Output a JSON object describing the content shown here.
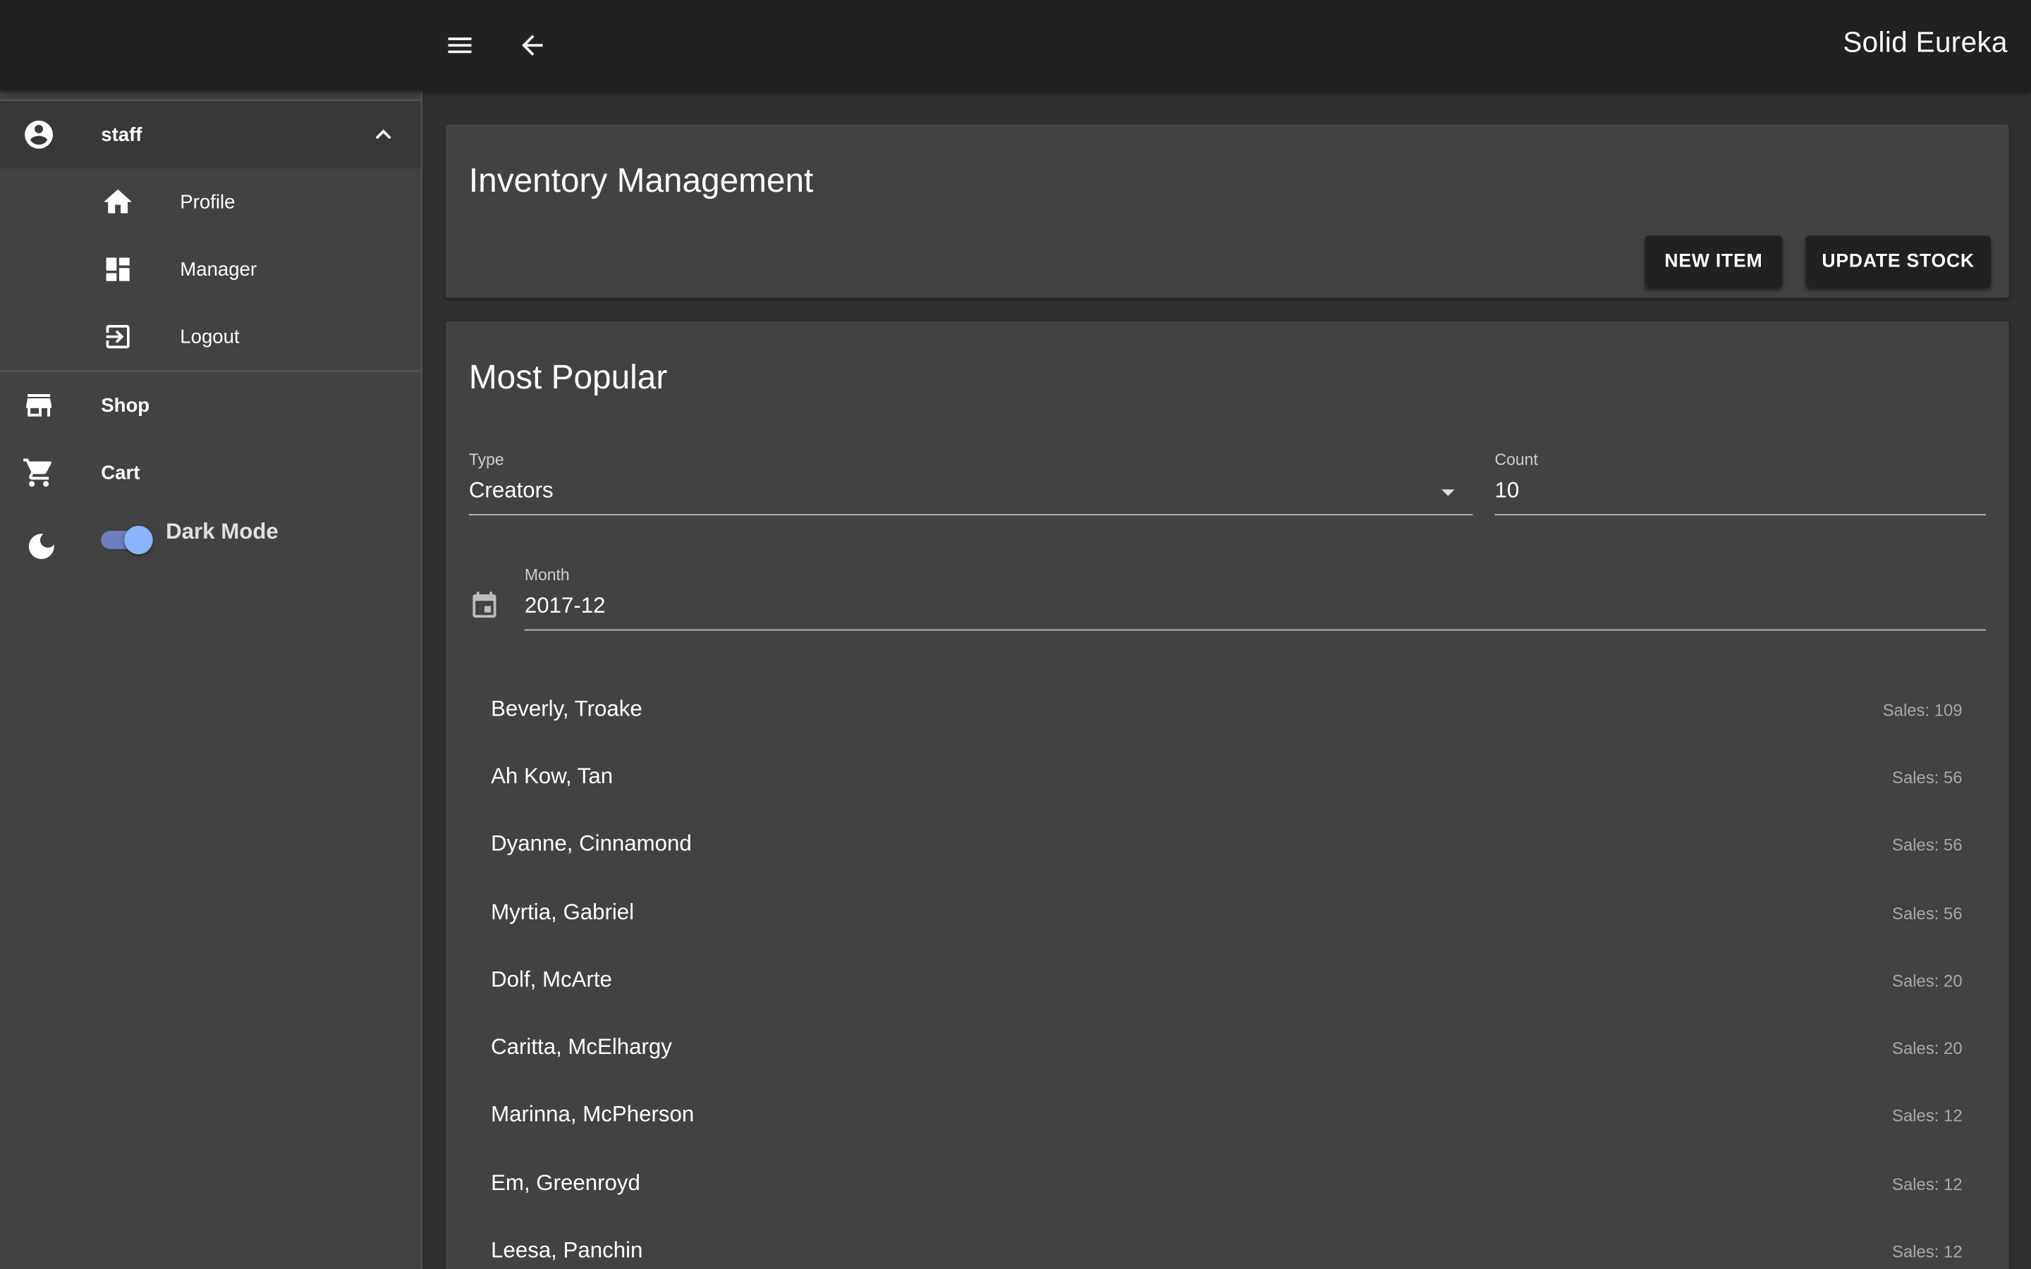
{
  "app": {
    "title": "Solid Eureka"
  },
  "appbar": {
    "menu_icon": "menu-icon",
    "back_icon": "arrow-back-icon"
  },
  "drawer": {
    "group": {
      "label": "staff",
      "icon": "account-circle-icon",
      "expanded": true
    },
    "group_items": [
      {
        "label": "Profile",
        "icon": "home-icon"
      },
      {
        "label": "Manager",
        "icon": "dashboard-icon"
      },
      {
        "label": "Logout",
        "icon": "logout-icon"
      }
    ],
    "items": [
      {
        "label": "Shop",
        "icon": "store-icon"
      },
      {
        "label": "Cart",
        "icon": "cart-icon"
      }
    ],
    "dark_mode": {
      "label": "Dark Mode",
      "icon": "moon-icon",
      "enabled": true
    }
  },
  "inventory": {
    "title": "Inventory Management",
    "new_item_label": "NEW ITEM",
    "update_stock_label": "UPDATE STOCK"
  },
  "popular": {
    "title": "Most Popular",
    "type": {
      "label": "Type",
      "value": "Creators"
    },
    "count": {
      "label": "Count",
      "value": "10"
    },
    "month": {
      "label": "Month",
      "value": "2017-12",
      "icon": "calendar-icon"
    },
    "rows": [
      {
        "name": "Beverly, Troake",
        "sales": "Sales: 109"
      },
      {
        "name": "Ah Kow, Tan",
        "sales": "Sales: 56"
      },
      {
        "name": "Dyanne, Cinnamond",
        "sales": "Sales: 56"
      },
      {
        "name": "Myrtia, Gabriel",
        "sales": "Sales: 56"
      },
      {
        "name": "Dolf, McArte",
        "sales": "Sales: 20"
      },
      {
        "name": "Caritta, McElhargy",
        "sales": "Sales: 20"
      },
      {
        "name": "Marinna, McPherson",
        "sales": "Sales: 12"
      },
      {
        "name": "Em, Greenroyd",
        "sales": "Sales: 12"
      },
      {
        "name": "Leesa, Panchin",
        "sales": "Sales: 12"
      }
    ]
  }
}
